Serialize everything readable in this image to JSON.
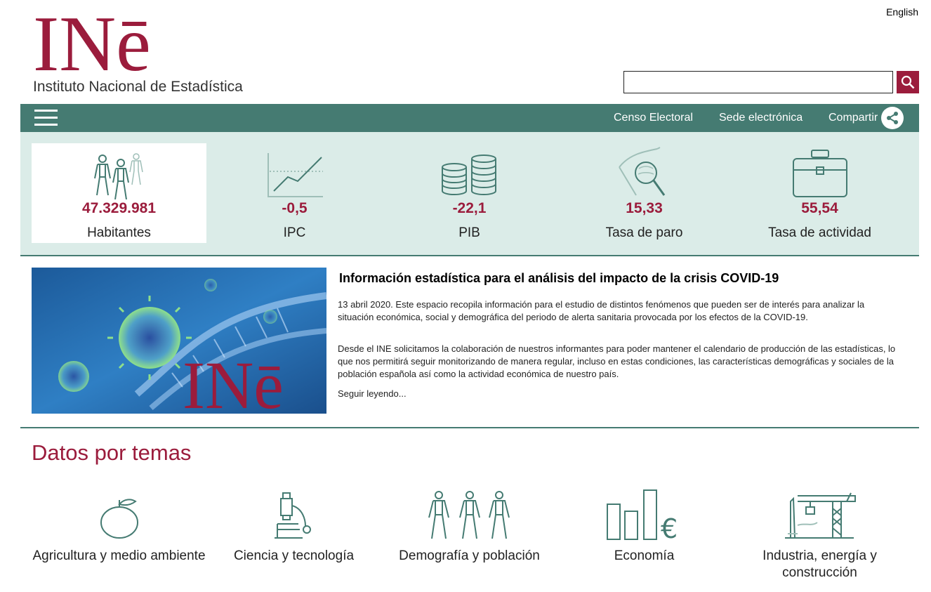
{
  "header": {
    "language_link": "English",
    "logo_text": "INē",
    "logo_subtitle": "Instituto Nacional de Estadística",
    "search_placeholder": "",
    "search_icon": "search-icon"
  },
  "nav": {
    "menu_icon": "hamburger-menu-icon",
    "links": [
      "Censo Electoral",
      "Sede electrónica",
      "Compartir"
    ],
    "share_icon": "share-icon"
  },
  "indicators": [
    {
      "value": "47.329.981",
      "label": "Habitantes",
      "icon": "people-icon"
    },
    {
      "value": "-0,5",
      "label": "IPC",
      "icon": "line-chart-icon"
    },
    {
      "value": "-22,1",
      "label": "PIB",
      "icon": "coins-icon"
    },
    {
      "value": "15,33",
      "label": "Tasa de paro",
      "icon": "magnifier-icon"
    },
    {
      "value": "55,54",
      "label": "Tasa de actividad",
      "icon": "briefcase-icon"
    }
  ],
  "feature": {
    "image_logo_text": "INē",
    "title": "Información estadística para el análisis del impacto de la crisis COVID-19",
    "paragraph1": "13 abril 2020. Este espacio recopila información para el estudio de distintos fenómenos que pueden ser de interés para analizar la situación económica, social y demográfica del periodo de alerta sanitaria provocada por los efectos de la COVID-19.",
    "paragraph2": "Desde el INE solicitamos la colaboración de nuestros informantes para poder mantener el calendario de producción de las estadísticas, lo que nos permitirá seguir monitorizando de manera regular, incluso en estas condiciones, las características demográficas y sociales de la población española así como la actividad económica de nuestro país.",
    "more_link": "Seguir leyendo..."
  },
  "themes": {
    "title": "Datos por temas",
    "items": [
      {
        "label": "Agricultura y medio ambiente",
        "icon": "apple-icon"
      },
      {
        "label": "Ciencia y tecnología",
        "icon": "microscope-icon"
      },
      {
        "label": "Demografía y población",
        "icon": "population-icon"
      },
      {
        "label": "Economía",
        "icon": "euro-bars-icon"
      },
      {
        "label": "Industria, energía y construcción",
        "icon": "crane-icon"
      }
    ]
  },
  "colors": {
    "brand": "#9b1c3c",
    "nav": "#457b72",
    "indicator_bg": "#dbece8",
    "icon_stroke": "#457b72"
  }
}
